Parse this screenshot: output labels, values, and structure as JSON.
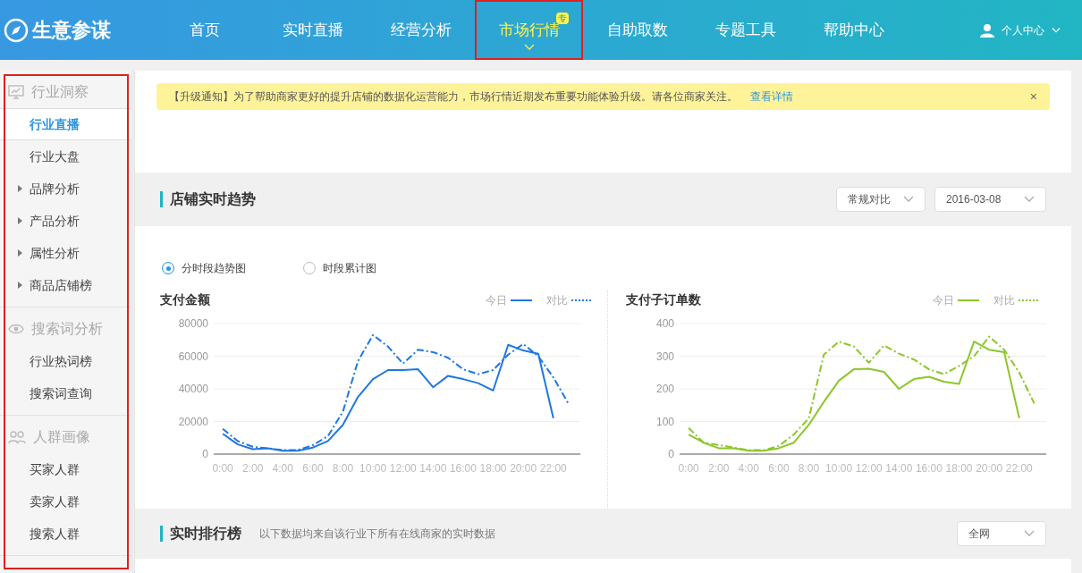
{
  "header": {
    "logo": "生意参谋",
    "nav": [
      {
        "label": "首页",
        "selected": false,
        "annotated": false
      },
      {
        "label": "实时直播",
        "selected": false,
        "annotated": false
      },
      {
        "label": "经营分析",
        "selected": false,
        "annotated": false
      },
      {
        "label": "市场行情",
        "selected": true,
        "annotated": true,
        "badge": "专"
      },
      {
        "label": "自助取数",
        "selected": false,
        "annotated": false
      },
      {
        "label": "专题工具",
        "selected": false,
        "annotated": false
      },
      {
        "label": "帮助中心",
        "selected": false,
        "annotated": false
      }
    ],
    "user_menu": "个人中心"
  },
  "sidebar": {
    "annotated": true,
    "groups": [
      {
        "title": "行业洞察",
        "kind": "monitor",
        "items": [
          {
            "label": "行业直播",
            "selected": true,
            "expandable": false
          },
          {
            "label": "行业大盘",
            "selected": false,
            "expandable": false
          },
          {
            "label": "品牌分析",
            "selected": false,
            "expandable": true
          },
          {
            "label": "产品分析",
            "selected": false,
            "expandable": true
          },
          {
            "label": "属性分析",
            "selected": false,
            "expandable": true
          },
          {
            "label": "商品店铺榜",
            "selected": false,
            "expandable": true
          }
        ]
      },
      {
        "title": "搜索词分析",
        "kind": "eye",
        "items": [
          {
            "label": "行业热词榜",
            "selected": false,
            "expandable": false
          },
          {
            "label": "搜索词查询",
            "selected": false,
            "expandable": false
          }
        ]
      },
      {
        "title": "人群画像",
        "kind": "people",
        "items": [
          {
            "label": "买家人群",
            "selected": false,
            "expandable": false
          },
          {
            "label": "卖家人群",
            "selected": false,
            "expandable": false
          },
          {
            "label": "搜索人群",
            "selected": false,
            "expandable": false
          }
        ]
      }
    ]
  },
  "notice": {
    "text": "【升级通知】为了帮助商家更好的提升店铺的数据化运营能力，市场行情近期发布重要功能体验升级。请各位商家关注。",
    "link": "查看详情",
    "close": "×"
  },
  "trend_section": {
    "title": "店铺实时趋势",
    "selects": [
      {
        "value": "常规对比"
      },
      {
        "value": "2016-03-08"
      }
    ],
    "radios": [
      {
        "label": "分时段趋势图",
        "selected": true
      },
      {
        "label": "时段累计图",
        "selected": false
      }
    ],
    "charts": [
      {
        "title": "支付金额",
        "chart_data": {
          "type": "line",
          "grid": true,
          "xlim": [
            -0.6,
            23.8
          ],
          "x": [
            0,
            1,
            2,
            3,
            4,
            5,
            6,
            7,
            8,
            9,
            10,
            11,
            12,
            13,
            14,
            15,
            16,
            17,
            18,
            19,
            20,
            21,
            22,
            23
          ],
          "ylim": [
            0,
            80000
          ],
          "yticks": [
            0,
            20000,
            40000,
            60000,
            80000
          ],
          "xticks": [
            {
              "value": 0,
              "label": "0:00"
            },
            {
              "value": 2,
              "label": "2:00"
            },
            {
              "value": 4,
              "label": "4:00"
            },
            {
              "value": 6,
              "label": "6:00"
            },
            {
              "value": 8,
              "label": "8:00"
            },
            {
              "value": 10,
              "label": "10:00"
            },
            {
              "value": 12,
              "label": "12:00"
            },
            {
              "value": 14,
              "label": "14:00"
            },
            {
              "value": 16,
              "label": "16:00"
            },
            {
              "value": 18,
              "label": "18:00"
            },
            {
              "value": 20,
              "label": "20:00"
            },
            {
              "value": 22,
              "label": "22:00"
            }
          ],
          "series": [
            {
              "name": "今日",
              "color": "#1e77e2",
              "line_style": "solid",
              "values": [
                12500,
                6000,
                3000,
                3500,
                2000,
                2000,
                4000,
                8000,
                18000,
                35000,
                46000,
                51500,
                51500,
                52000,
                41000,
                48000,
                46000,
                43500,
                39000,
                67000,
                63500,
                61500,
                22000,
                null
              ]
            },
            {
              "name": "对比",
              "color": "#1e77e2",
              "line_style": "dashdot",
              "values": [
                15500,
                8000,
                4500,
                3500,
                2500,
                2500,
                5500,
                11000,
                26000,
                57000,
                73000,
                66000,
                55500,
                64000,
                62500,
                59000,
                52000,
                49000,
                51500,
                61000,
                67500,
                60000,
                47000,
                31000
              ]
            }
          ]
        }
      },
      {
        "title": "支付子订单数",
        "chart_data": {
          "type": "line",
          "grid": true,
          "xlim": [
            -0.6,
            23.8
          ],
          "x": [
            0,
            1,
            2,
            3,
            4,
            5,
            6,
            7,
            8,
            9,
            10,
            11,
            12,
            13,
            14,
            15,
            16,
            17,
            18,
            19,
            20,
            21,
            22,
            23
          ],
          "ylim": [
            0,
            400
          ],
          "yticks": [
            0,
            100,
            200,
            300,
            400
          ],
          "xticks": [
            {
              "value": 0,
              "label": "0:00"
            },
            {
              "value": 2,
              "label": "2:00"
            },
            {
              "value": 4,
              "label": "4:00"
            },
            {
              "value": 6,
              "label": "6:00"
            },
            {
              "value": 8,
              "label": "8:00"
            },
            {
              "value": 10,
              "label": "10:00"
            },
            {
              "value": 12,
              "label": "12:00"
            },
            {
              "value": 14,
              "label": "14:00"
            },
            {
              "value": 16,
              "label": "16:00"
            },
            {
              "value": 18,
              "label": "18:00"
            },
            {
              "value": 20,
              "label": "20:00"
            },
            {
              "value": 22,
              "label": "22:00"
            }
          ],
          "series": [
            {
              "name": "今日",
              "color": "#8cc62a",
              "line_style": "solid",
              "values": [
                60,
                35,
                18,
                18,
                10,
                10,
                18,
                35,
                90,
                160,
                225,
                260,
                262,
                252,
                200,
                230,
                237,
                222,
                215,
                345,
                320,
                312,
                110,
                null
              ]
            },
            {
              "name": "对比",
              "color": "#8cc62a",
              "line_style": "dashdot",
              "values": [
                80,
                35,
                28,
                20,
                12,
                12,
                25,
                60,
                110,
                305,
                345,
                330,
                280,
                333,
                308,
                290,
                260,
                245,
                270,
                300,
                360,
                320,
                250,
                155
              ]
            }
          ]
        }
      }
    ]
  },
  "ranking_section": {
    "title": "实时排行榜",
    "subtitle": "以下数据均来自该行业下所有在线商家的实时数据",
    "select": {
      "value": "全网"
    }
  }
}
